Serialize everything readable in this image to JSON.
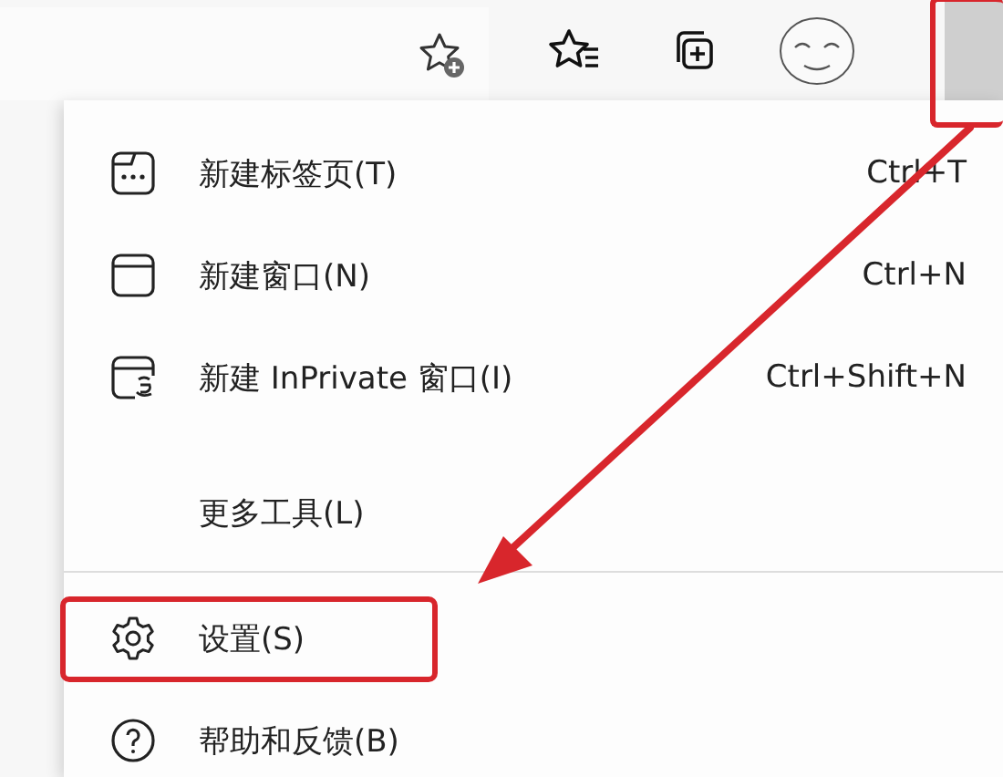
{
  "toolbar": {
    "buttons": [
      {
        "kind": "star-add"
      },
      {
        "kind": "favorites"
      },
      {
        "kind": "collections"
      },
      {
        "kind": "avatar"
      },
      {
        "kind": "menu",
        "highlighted": true
      }
    ]
  },
  "menu": {
    "items": [
      {
        "kind": "tab",
        "label": "新建标签页(T)",
        "shortcut": "Ctrl+T",
        "highlighted": false,
        "divider_before": false
      },
      {
        "kind": "window",
        "label": "新建窗口(N)",
        "shortcut": "Ctrl+N",
        "highlighted": false,
        "divider_before": false
      },
      {
        "kind": "inprivate",
        "label": "新建 InPrivate 窗口(I)",
        "shortcut": "Ctrl+Shift+N",
        "highlighted": false,
        "divider_before": false
      },
      {
        "kind": "plain",
        "label": "更多工具(L)",
        "highlighted": false,
        "divider_before": false,
        "gap_before": true
      },
      {
        "kind": "gear",
        "label": "设置(S)",
        "highlighted": true,
        "divider_before": true
      },
      {
        "kind": "help",
        "label": "帮助和反馈(B)",
        "highlighted": false,
        "divider_before": false
      }
    ]
  }
}
